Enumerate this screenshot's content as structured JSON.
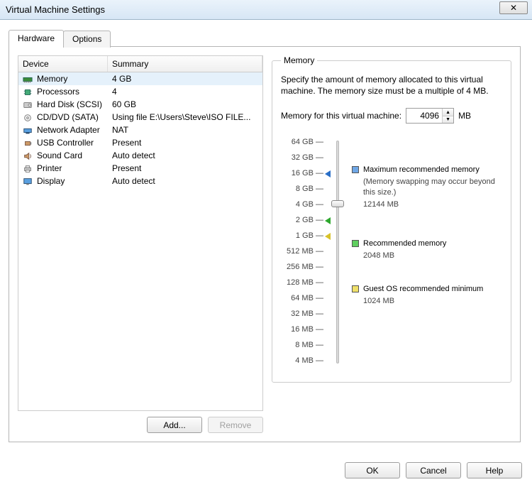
{
  "window": {
    "title": "Virtual Machine Settings"
  },
  "tabs": {
    "hardware": "Hardware",
    "options": "Options"
  },
  "list": {
    "header_device": "Device",
    "header_summary": "Summary",
    "items": [
      {
        "icon": "memory-icon",
        "name": "Memory",
        "summary": "4 GB",
        "selected": true
      },
      {
        "icon": "cpu-icon",
        "name": "Processors",
        "summary": "4"
      },
      {
        "icon": "hdd-icon",
        "name": "Hard Disk (SCSI)",
        "summary": "60 GB"
      },
      {
        "icon": "cd-icon",
        "name": "CD/DVD (SATA)",
        "summary": "Using file E:\\Users\\Steve\\ISO FILE..."
      },
      {
        "icon": "net-icon",
        "name": "Network Adapter",
        "summary": "NAT"
      },
      {
        "icon": "usb-icon",
        "name": "USB Controller",
        "summary": "Present"
      },
      {
        "icon": "sound-icon",
        "name": "Sound Card",
        "summary": "Auto detect"
      },
      {
        "icon": "printer-icon",
        "name": "Printer",
        "summary": "Present"
      },
      {
        "icon": "display-icon",
        "name": "Display",
        "summary": "Auto detect"
      }
    ]
  },
  "buttons": {
    "add": "Add...",
    "remove": "Remove",
    "ok": "OK",
    "cancel": "Cancel",
    "help": "Help"
  },
  "memory": {
    "group_label": "Memory",
    "desc": "Specify the amount of memory allocated to this virtual machine. The memory size must be a multiple of 4 MB.",
    "input_label": "Memory for this virtual machine:",
    "value": "4096",
    "unit": "MB",
    "ticks": [
      "64 GB",
      "32 GB",
      "16 GB",
      "8 GB",
      "4 GB",
      "2 GB",
      "1 GB",
      "512 MB",
      "256 MB",
      "128 MB",
      "64 MB",
      "32 MB",
      "16 MB",
      "8 MB",
      "4 MB"
    ],
    "legend": {
      "max_label": "Maximum recommended memory",
      "max_note": "(Memory swapping may occur beyond this size.)",
      "max_value": "12144 MB",
      "rec_label": "Recommended memory",
      "rec_value": "2048 MB",
      "min_label": "Guest OS recommended minimum",
      "min_value": "1024 MB"
    }
  }
}
